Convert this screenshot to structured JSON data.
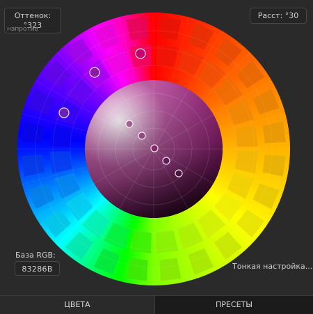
{
  "hue_field": {
    "label": "Оттенок:",
    "value": "°323",
    "sublabel": "напротив"
  },
  "distance_field": {
    "label": "Расст: °30"
  },
  "base_rgb": {
    "label": "База RGB:",
    "value": "83286B"
  },
  "fine_tune": {
    "label": "Тонкая настройка..."
  },
  "tabs": [
    {
      "label": "ЦВЕТА",
      "active": true
    },
    {
      "label": "ПРЕСЕТЫ",
      "active": false
    }
  ],
  "wheel": {
    "base_color": "#83286B",
    "hue_rotation_deg": 0,
    "outer_markers": 3,
    "inner_markers": 5
  },
  "icons": [
    "hue-marker-icon",
    "inner-marker-icon"
  ]
}
